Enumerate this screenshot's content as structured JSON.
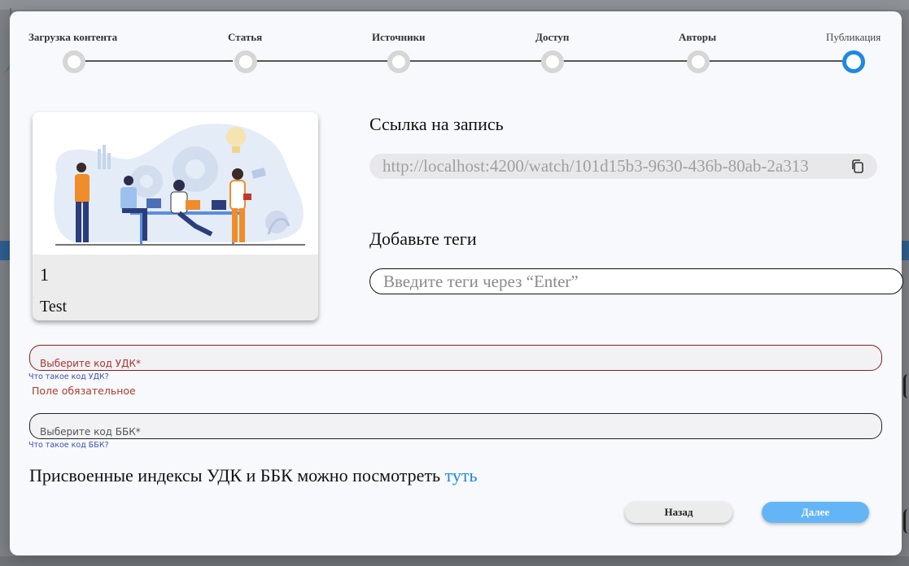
{
  "stepper": {
    "steps": [
      {
        "label": "Загрузка контента"
      },
      {
        "label": "Статья"
      },
      {
        "label": "Источники"
      },
      {
        "label": "Доступ"
      },
      {
        "label": "Авторы"
      },
      {
        "label": "Публикация"
      }
    ],
    "active_step": "Публикация"
  },
  "card": {
    "number": "1",
    "title": "Test"
  },
  "link_section": {
    "heading": "Ссылка на запись",
    "url": "http://localhost:4200/watch/101d15b3-9630-436b-80ab-2a313",
    "copy_icon": "copy-icon"
  },
  "tags_section": {
    "heading": "Добавьте теги",
    "placeholder": "Введите теги через “Enter”",
    "value": ""
  },
  "udk": {
    "placeholder": "Выберите код УДК*",
    "help": "Что такое код УДК?",
    "error": "Поле обязательное"
  },
  "bbk": {
    "placeholder": "Выберите код ББК*",
    "help": "Что такое код ББК?"
  },
  "index_note": {
    "text": "Присвоенные индексы УДК и ББК можно посмотреть ",
    "link": "туть"
  },
  "buttons": {
    "back": "Назад",
    "next": "Далее"
  },
  "colors": {
    "accent": "#1e88e5",
    "next_button": "#64b5f6",
    "error": "#b23a2a",
    "link": "#3b4fb8"
  }
}
